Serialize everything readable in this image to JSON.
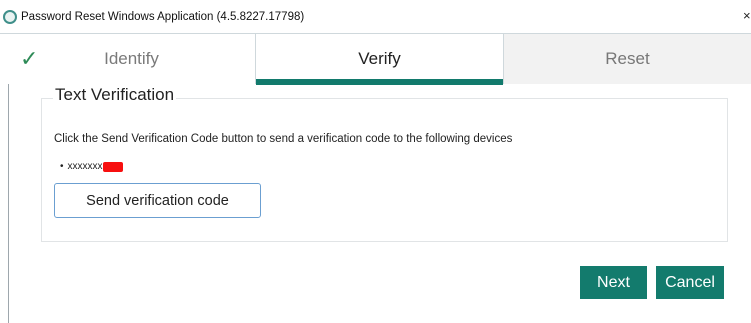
{
  "window": {
    "title": "Password Reset Windows Application (4.5.8227.17798)",
    "close_glyph": "×"
  },
  "steps": [
    {
      "label": "Identify",
      "state": "completed",
      "icon": "checkmark-icon"
    },
    {
      "label": "Verify",
      "state": "active"
    },
    {
      "label": "Reset",
      "state": "pending"
    }
  ],
  "panel": {
    "title": "Text Verification",
    "description": "Click the Send Verification Code button to send a verification code to the following devices",
    "devices": [
      {
        "bullet": "•",
        "value": "xxxxxxx",
        "redacted": true
      }
    ],
    "send_button_label": "Send verification code"
  },
  "footer": {
    "next_label": "Next",
    "cancel_label": "Cancel"
  },
  "colors": {
    "accent": "#137b6d",
    "check": "#2e8b57",
    "redaction": "#f70f0f",
    "button_border": "#6b9fd1"
  }
}
